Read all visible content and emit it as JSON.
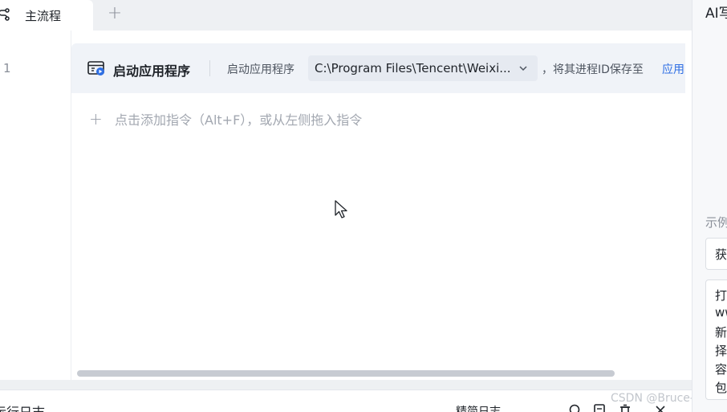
{
  "tabs": {
    "active_label": "主流程",
    "add_symbol": "+"
  },
  "editor": {
    "line_number": "1",
    "command": {
      "title": "启动应用程序",
      "description": "启动应用程序",
      "path_value": "C:\\Program Files\\Tencent\\Weixi...",
      "tail_text": "，将其进程ID保存至",
      "variable_text": "应用"
    },
    "add_hint": "点击添加指令（Alt+F），或从左侧拖入指令",
    "add_symbol": "+"
  },
  "bottom": {
    "log_title": "运行日志",
    "log_mode": "精简日志",
    "watermark": "CSDN @Bruce-li__"
  },
  "ai_panel": {
    "title": "AI写",
    "examples_label": "示例",
    "card1_text": "获",
    "card2_lines": [
      "打",
      "ww",
      "新",
      "择",
      "容",
      "包"
    ]
  },
  "colors": {
    "accent": "#2f6fe4",
    "command_row_bg": "#f0f3f8",
    "path_box_bg": "#e6eaf1"
  }
}
